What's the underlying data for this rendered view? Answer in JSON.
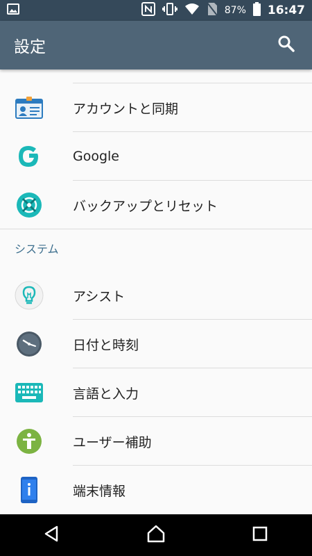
{
  "status_bar": {
    "battery_percent": "87%",
    "time": "16:47"
  },
  "app_bar": {
    "title": "設定"
  },
  "items": [
    {
      "label": "アカウントと同期",
      "icon": "account-card-icon"
    },
    {
      "label": "Google",
      "icon": "google-icon"
    },
    {
      "label": "バックアップとリセット",
      "icon": "backup-reset-icon"
    }
  ],
  "section_system": {
    "header": "システム",
    "items": [
      {
        "label": "アシスト",
        "icon": "lightbulb-icon"
      },
      {
        "label": "日付と時刻",
        "icon": "clock-icon"
      },
      {
        "label": "言語と入力",
        "icon": "keyboard-icon"
      },
      {
        "label": "ユーザー補助",
        "icon": "accessibility-icon"
      },
      {
        "label": "端末情報",
        "icon": "device-info-icon"
      }
    ]
  },
  "colors": {
    "app_bar": "#4f6577",
    "status_bar": "#35495a",
    "section_header": "#3d6f8e",
    "teal_accent": "#1bb8b8"
  }
}
